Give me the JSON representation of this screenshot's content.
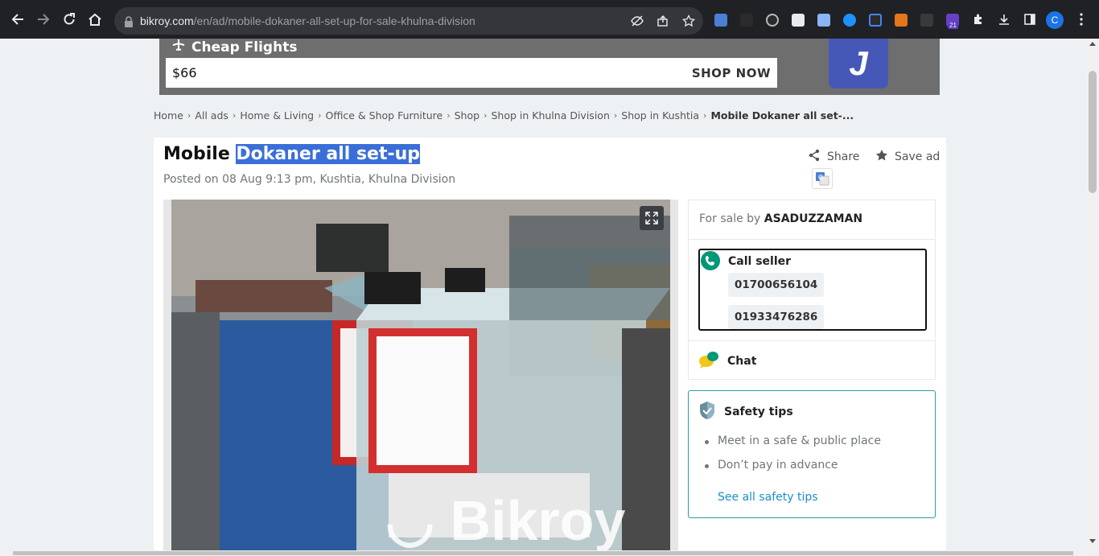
{
  "browser": {
    "url_host": "bikroy.com",
    "url_path": "/en/ad/mobile-dokaner-all-set-up-for-sale-khulna-division",
    "extension_badge": "21",
    "profile_initial": "C"
  },
  "banner": {
    "title": "Cheap Flights",
    "price": "$66",
    "cta": "SHOP NOW",
    "logo_letter": "J"
  },
  "breadcrumb": {
    "items": [
      "Home",
      "All ads",
      "Home & Living",
      "Office & Shop Furniture",
      "Shop",
      "Shop in Khulna Division",
      "Shop in Kushtia"
    ],
    "current": "Mobile Dokaner all set-..."
  },
  "ad": {
    "title_plain": "Mobile ",
    "title_highlight": "Dokaner all set-up",
    "posted": "Posted on 08 Aug 9:13 pm, Kushtia, Khulna Division",
    "share_label": "Share",
    "save_label": "Save ad",
    "watermark": "Bikroy"
  },
  "seller": {
    "for_sale_prefix": "For sale by ",
    "name": "ASADUZZAMAN",
    "call_label": "Call seller",
    "phones": [
      "01700656104",
      "01933476286"
    ],
    "chat_label": "Chat"
  },
  "safety": {
    "title": "Safety tips",
    "tips": [
      "Meet in a safe & public place",
      "Don’t pay in advance"
    ],
    "link": "See all safety tips"
  },
  "colors": {
    "accent_teal": "#2a9ba5",
    "call_green": "#009877",
    "link_blue": "#1a8fc7",
    "highlight": "#3a6fd8"
  }
}
